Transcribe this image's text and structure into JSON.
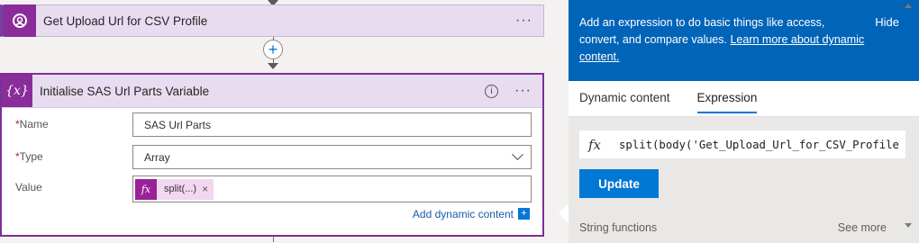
{
  "flow": {
    "top_action": {
      "title": "Get Upload Url for CSV Profile",
      "more": "···"
    },
    "insert_step": "+",
    "main_action": {
      "icon_text": "{x}",
      "title": "Initialise SAS Url Parts Variable",
      "info": "i",
      "more": "···",
      "fields": {
        "name": {
          "label": "Name",
          "required_mark": "*",
          "value": "SAS Url Parts"
        },
        "type": {
          "label": "Type",
          "required_mark": "*",
          "value": "Array"
        },
        "value": {
          "label": "Value",
          "token_icon": "fx",
          "token_label": "split(...)",
          "token_remove": "×"
        }
      },
      "add_dynamic": "Add dynamic content",
      "add_dynamic_icon": "+"
    }
  },
  "panel": {
    "description": "Add an expression to do basic things like access, convert, and compare values.",
    "learn_more": "Learn more about dynamic content.",
    "hide": "Hide",
    "tabs": [
      {
        "label": "Dynamic content",
        "active": false
      },
      {
        "label": "Expression",
        "active": true
      }
    ],
    "expression_icon": "fx",
    "expression": "split(body('Get_Upload_Url_for_CSV_Profile",
    "update_button": "Update",
    "section_title": "String functions",
    "see_more": "See more"
  },
  "colors": {
    "accent": "#0078d4",
    "header": "#0064b9",
    "variable_purple": "#8a2c9a",
    "card_border": "#7a2f9c"
  }
}
